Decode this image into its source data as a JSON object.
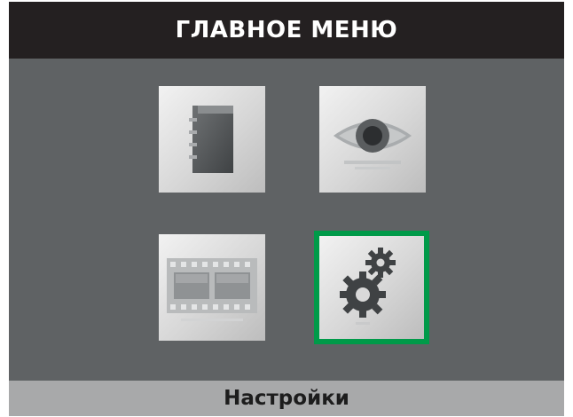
{
  "header": {
    "title": "ГЛАВНОЕ МЕНЮ"
  },
  "menu": {
    "items": [
      {
        "icon": "notebook-icon",
        "selected": false
      },
      {
        "icon": "eye-icon",
        "selected": false
      },
      {
        "icon": "film-icon",
        "selected": false
      },
      {
        "icon": "gears-icon",
        "selected": true
      }
    ]
  },
  "status": {
    "selected_label": "Настройки"
  },
  "colors": {
    "background": "#5f6264",
    "title_bar": "#242021",
    "status_bar": "#a8a9aa",
    "selection": "#009a49"
  }
}
